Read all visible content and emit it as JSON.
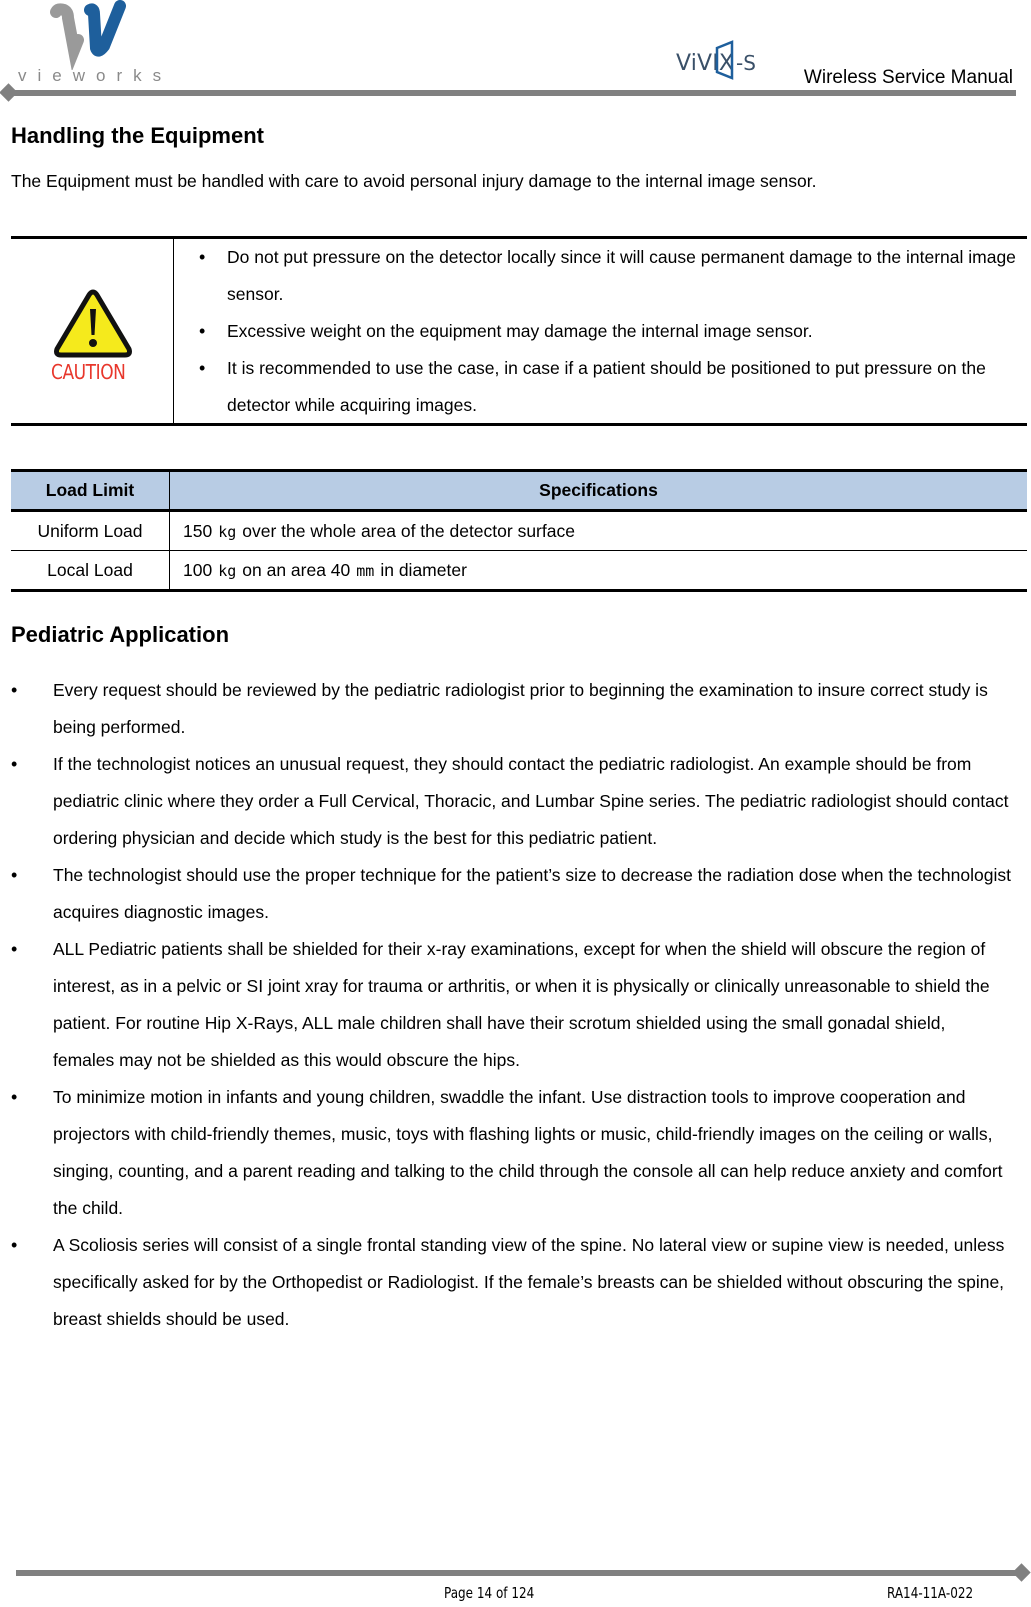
{
  "header": {
    "company_logo_text": "vieworks",
    "product_logo_text": "ViVIX-S",
    "manual_title": "Wireless Service Manual"
  },
  "handling": {
    "title": "Handling the Equipment",
    "intro": "The Equipment must be handled with care to avoid personal injury damage to the internal image sensor.",
    "caution": {
      "icon": "caution-warning-icon",
      "label": "CAUTION",
      "bullets": [
        "Do not put pressure on the detector locally since it will cause permanent damage to the internal image sensor.",
        "Excessive weight on the equipment may damage the internal image sensor.",
        "It is recommended to use the case, in case if a patient should be positioned to put pressure on the detector while acquiring images."
      ]
    }
  },
  "load_table": {
    "headers": [
      "Load Limit",
      "Specifications"
    ],
    "rows": [
      {
        "label": "Uniform Load",
        "value": "150",
        "unit": "kg",
        "rest": "over the whole area of the detector surface"
      },
      {
        "label": "Local Load",
        "value": "100",
        "unit": "kg",
        "mid": "on an area 40",
        "unit2": "mm",
        "rest": "in diameter"
      }
    ]
  },
  "pediatric": {
    "title": "Pediatric Application",
    "bullets": [
      "Every request should be reviewed by the pediatric radiologist prior to beginning the examination to insure correct study is being performed.",
      "If the technologist notices an unusual request, they should contact the pediatric radiologist. An example should be from pediatric clinic where they order a Full Cervical, Thoracic, and Lumbar Spine series. The pediatric radiologist should contact ordering physician and decide which study is the best for this pediatric patient.",
      "The technologist should use the proper technique for the patient’s size to decrease the radiation dose when the technologist acquires diagnostic images.",
      "ALL Pediatric patients shall be shielded for their x-ray examinations, except for when the shield will obscure the region of interest, as in a pelvic or SI joint xray for trauma or arthritis, or when it is physically or clinically unreasonable to shield the patient. For routine Hip X-Rays, ALL male children shall have their scrotum shielded using the small gonadal shield, females may not be shielded as this would obscure the hips.",
      "To minimize motion in infants and young children, swaddle the infant. Use distraction tools to improve cooperation and projectors with child-friendly themes, music, toys with flashing lights or music, child-friendly images on the ceiling or walls, singing, counting, and a parent reading and talking to the child through the console all can help reduce anxiety and comfort the child.",
      "A Scoliosis series will consist of a single frontal standing view of the spine. No lateral view or supine view is needed, unless specifically asked for by the Orthopedist or Radiologist. If the female’s breasts can be shielded without obscuring the spine, breast shields should be used."
    ]
  },
  "footer": {
    "page": "Page 14 of 124",
    "doc_code": "RA14-11A-022"
  },
  "bullet_glyph": "•",
  "colors": {
    "rule_gray": "#808080",
    "table_header_bg": "#b8cce4",
    "caution_red": "#e8372c",
    "caution_yellow": "#f5ea1c",
    "logo_blue": "#1e5f9c",
    "logo_gray": "#9a9a9a"
  }
}
